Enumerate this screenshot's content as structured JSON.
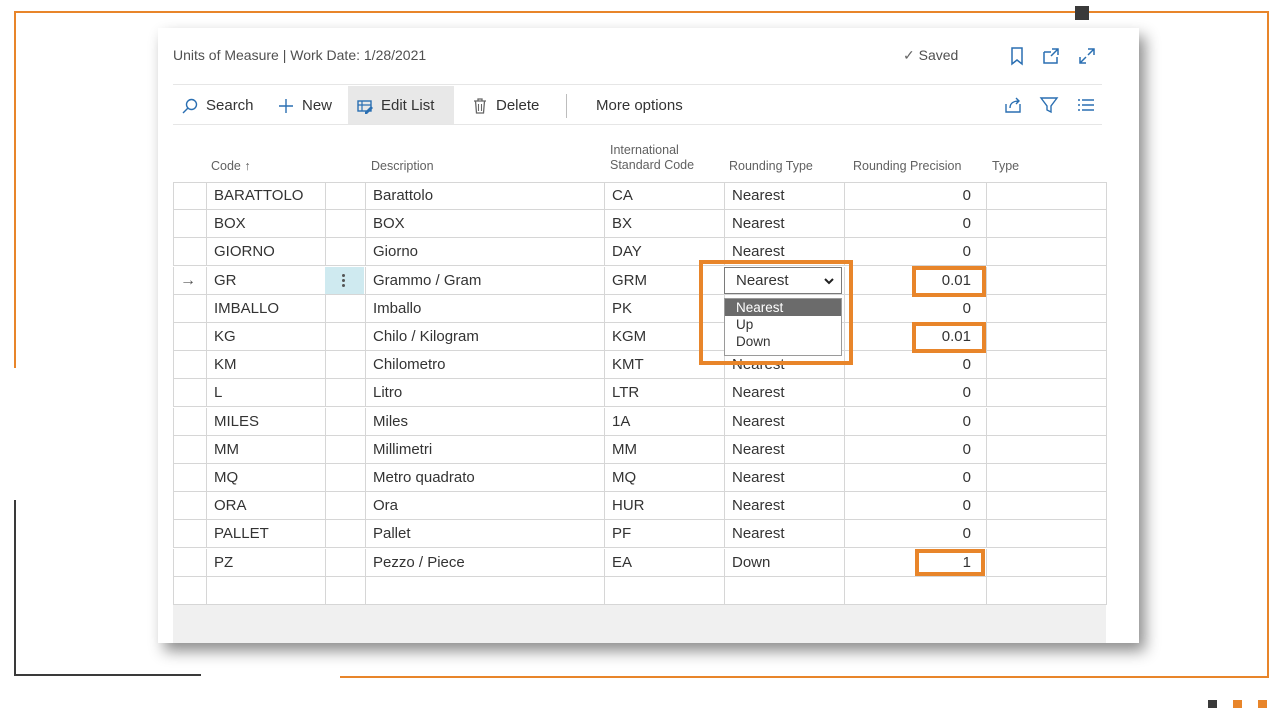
{
  "window": {
    "title": "Units of Measure | Work Date: 1/28/2021",
    "saved_label": "Saved"
  },
  "toolbar": {
    "search": "Search",
    "new": "New",
    "edit_list": "Edit List",
    "delete": "Delete",
    "more_options": "More options"
  },
  "headers": {
    "code": "Code",
    "description": "Description",
    "isc_line1": "International",
    "isc_line2": "Standard Code",
    "rounding_type": "Rounding Type",
    "rounding_precision": "Rounding Precision",
    "type": "Type"
  },
  "rows": [
    {
      "code": "BARATTOLO",
      "description": "Barattolo",
      "isc": "CA",
      "rounding_type": "Nearest",
      "precision": "0"
    },
    {
      "code": "BOX",
      "description": "BOX",
      "isc": "BX",
      "rounding_type": "Nearest",
      "precision": "0"
    },
    {
      "code": "GIORNO",
      "description": "Giorno",
      "isc": "DAY",
      "rounding_type": "Nearest",
      "precision": "0"
    },
    {
      "code": "GR",
      "description": "Grammo / Gram",
      "isc": "GRM",
      "rounding_type": "Nearest",
      "precision": "0.01"
    },
    {
      "code": "IMBALLO",
      "description": "Imballo",
      "isc": "PK",
      "rounding_type": "Nearest",
      "precision": "0"
    },
    {
      "code": "KG",
      "description": "Chilo / Kilogram",
      "isc": "KGM",
      "rounding_type": "Nearest",
      "precision": "0.01"
    },
    {
      "code": "KM",
      "description": "Chilometro",
      "isc": "KMT",
      "rounding_type": "Nearest",
      "precision": "0"
    },
    {
      "code": "L",
      "description": "Litro",
      "isc": "LTR",
      "rounding_type": "Nearest",
      "precision": "0"
    },
    {
      "code": "MILES",
      "description": "Miles",
      "isc": "1A",
      "rounding_type": "Nearest",
      "precision": "0"
    },
    {
      "code": "MM",
      "description": "Millimetri",
      "isc": "MM",
      "rounding_type": "Nearest",
      "precision": "0"
    },
    {
      "code": "MQ",
      "description": "Metro quadrato",
      "isc": "MQ",
      "rounding_type": "Nearest",
      "precision": "0"
    },
    {
      "code": "ORA",
      "description": "Ora",
      "isc": "HUR",
      "rounding_type": "Nearest",
      "precision": "0"
    },
    {
      "code": "PALLET",
      "description": "Pallet",
      "isc": "PF",
      "rounding_type": "Nearest",
      "precision": "0"
    },
    {
      "code": "PZ",
      "description": "Pezzo / Piece",
      "isc": "EA",
      "rounding_type": "Down",
      "precision": "1"
    }
  ],
  "dropdown": {
    "value": "Nearest",
    "options": [
      "Nearest",
      "Up",
      "Down"
    ]
  },
  "colors": {
    "accent_orange": "#e8852a",
    "selected_cell": "#cfeaf0",
    "link_blue": "#2a6fb2"
  }
}
